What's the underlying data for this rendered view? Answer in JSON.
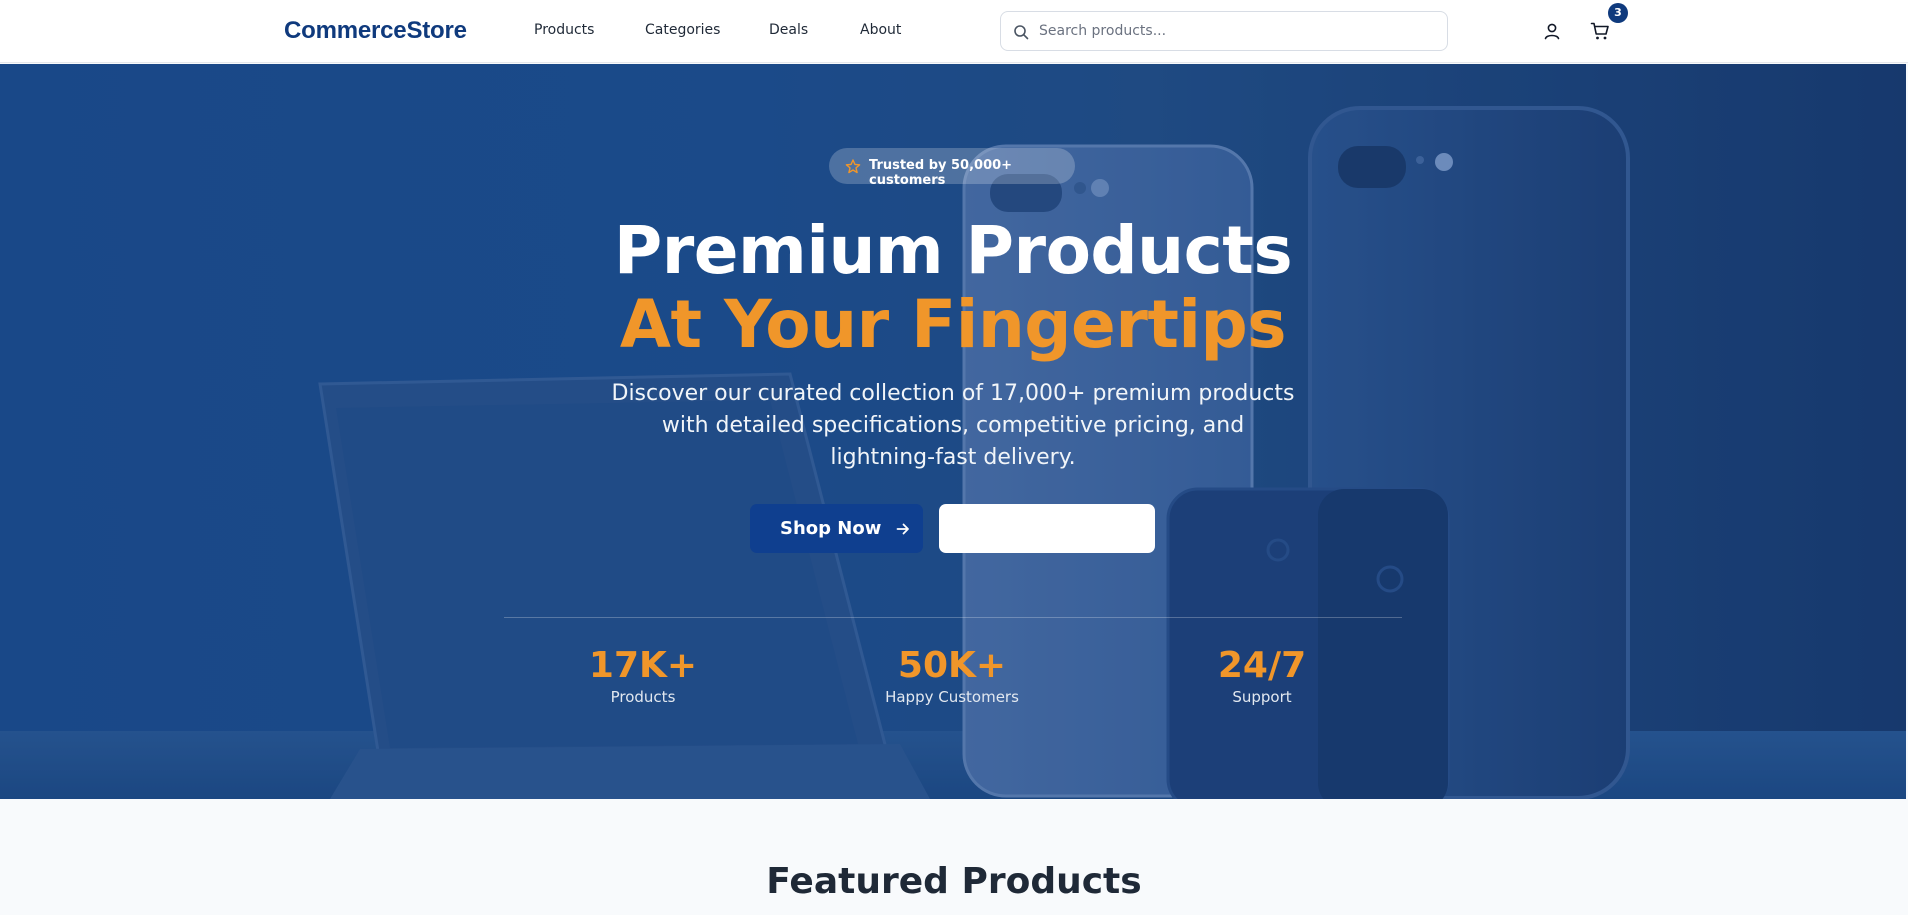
{
  "nav": {
    "logo": "CommerceStore",
    "links": [
      "Products",
      "Categories",
      "Deals",
      "About"
    ],
    "search_placeholder": "Search products...",
    "cart_count": "3"
  },
  "hero": {
    "badge": "Trusted by 50,000+ customers",
    "headline_line1": "Premium Products",
    "headline_line2": "At Your Fingertips",
    "subtext": "Discover our curated collection of 17,000+ premium products with detailed specifications, competitive pricing, and lightning-fast delivery.",
    "primary_button": "Shop Now",
    "secondary_button": "",
    "stats": [
      {
        "value": "17K+",
        "label": "Products"
      },
      {
        "value": "50K+",
        "label": "Happy Customers"
      },
      {
        "value": "24/7",
        "label": "Support"
      }
    ]
  },
  "featured": {
    "title": "Featured Products"
  },
  "colors": {
    "brand": "#0f3a7d",
    "accent": "#f0962a",
    "hero_bg": "#1e4f8f"
  },
  "icons": [
    "search-icon",
    "user-icon",
    "cart-icon",
    "star-icon",
    "arrow-right-icon"
  ]
}
